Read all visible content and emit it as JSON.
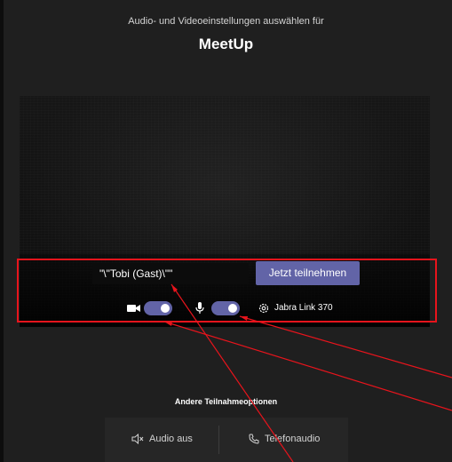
{
  "header": {
    "subtitle": "Audio- und Videoeinstellungen auswählen für",
    "meeting_title": "MeetUp"
  },
  "join": {
    "name_value": "\"\\\"Tobi (Gast)\\\"\"",
    "join_label": "Jetzt teilnehmen"
  },
  "devices": {
    "camera_on": true,
    "mic_on": true,
    "device_name": "Jabra Link 370"
  },
  "other": {
    "heading": "Andere Teilnahmeoptionen",
    "audio_off_label": "Audio aus",
    "phone_audio_label": "Telefonaudio"
  },
  "colors": {
    "accent": "#6264a7",
    "annotation": "#e8141c",
    "background": "#1f1f1f"
  },
  "icons": [
    "camera-icon",
    "microphone-icon",
    "gear-icon",
    "speaker-muted-icon",
    "phone-icon"
  ]
}
